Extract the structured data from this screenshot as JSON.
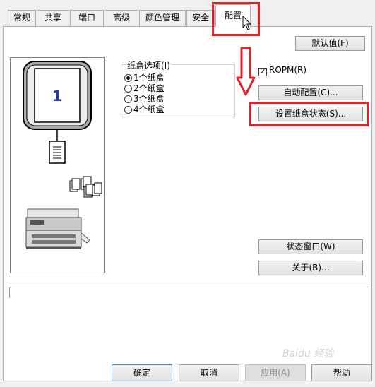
{
  "tabs": [
    "常规",
    "共享",
    "端口",
    "高级",
    "颜色管理",
    "安全",
    "配置"
  ],
  "buttons": {
    "defaults": "默认值(F)",
    "auto_config": "自动配置(C)...",
    "set_tray_status": "设置纸盒状态(S)...",
    "status_window": "状态窗口(W)",
    "about": "关于(B)...",
    "ok": "确定",
    "cancel": "取消",
    "apply": "应用(A)",
    "help": "帮助"
  },
  "tray_options": {
    "title": "纸盒选项(I)",
    "options": [
      "1个纸盒",
      "2个纸盒",
      "3个纸盒",
      "4个纸盒"
    ],
    "selected_index": 0
  },
  "ropm": {
    "label": "ROPM(R)",
    "checked": true
  },
  "preview": {
    "tray_number": "1"
  },
  "watermark": "Baidu 经验",
  "colors": {
    "highlight": "#e0202a"
  }
}
